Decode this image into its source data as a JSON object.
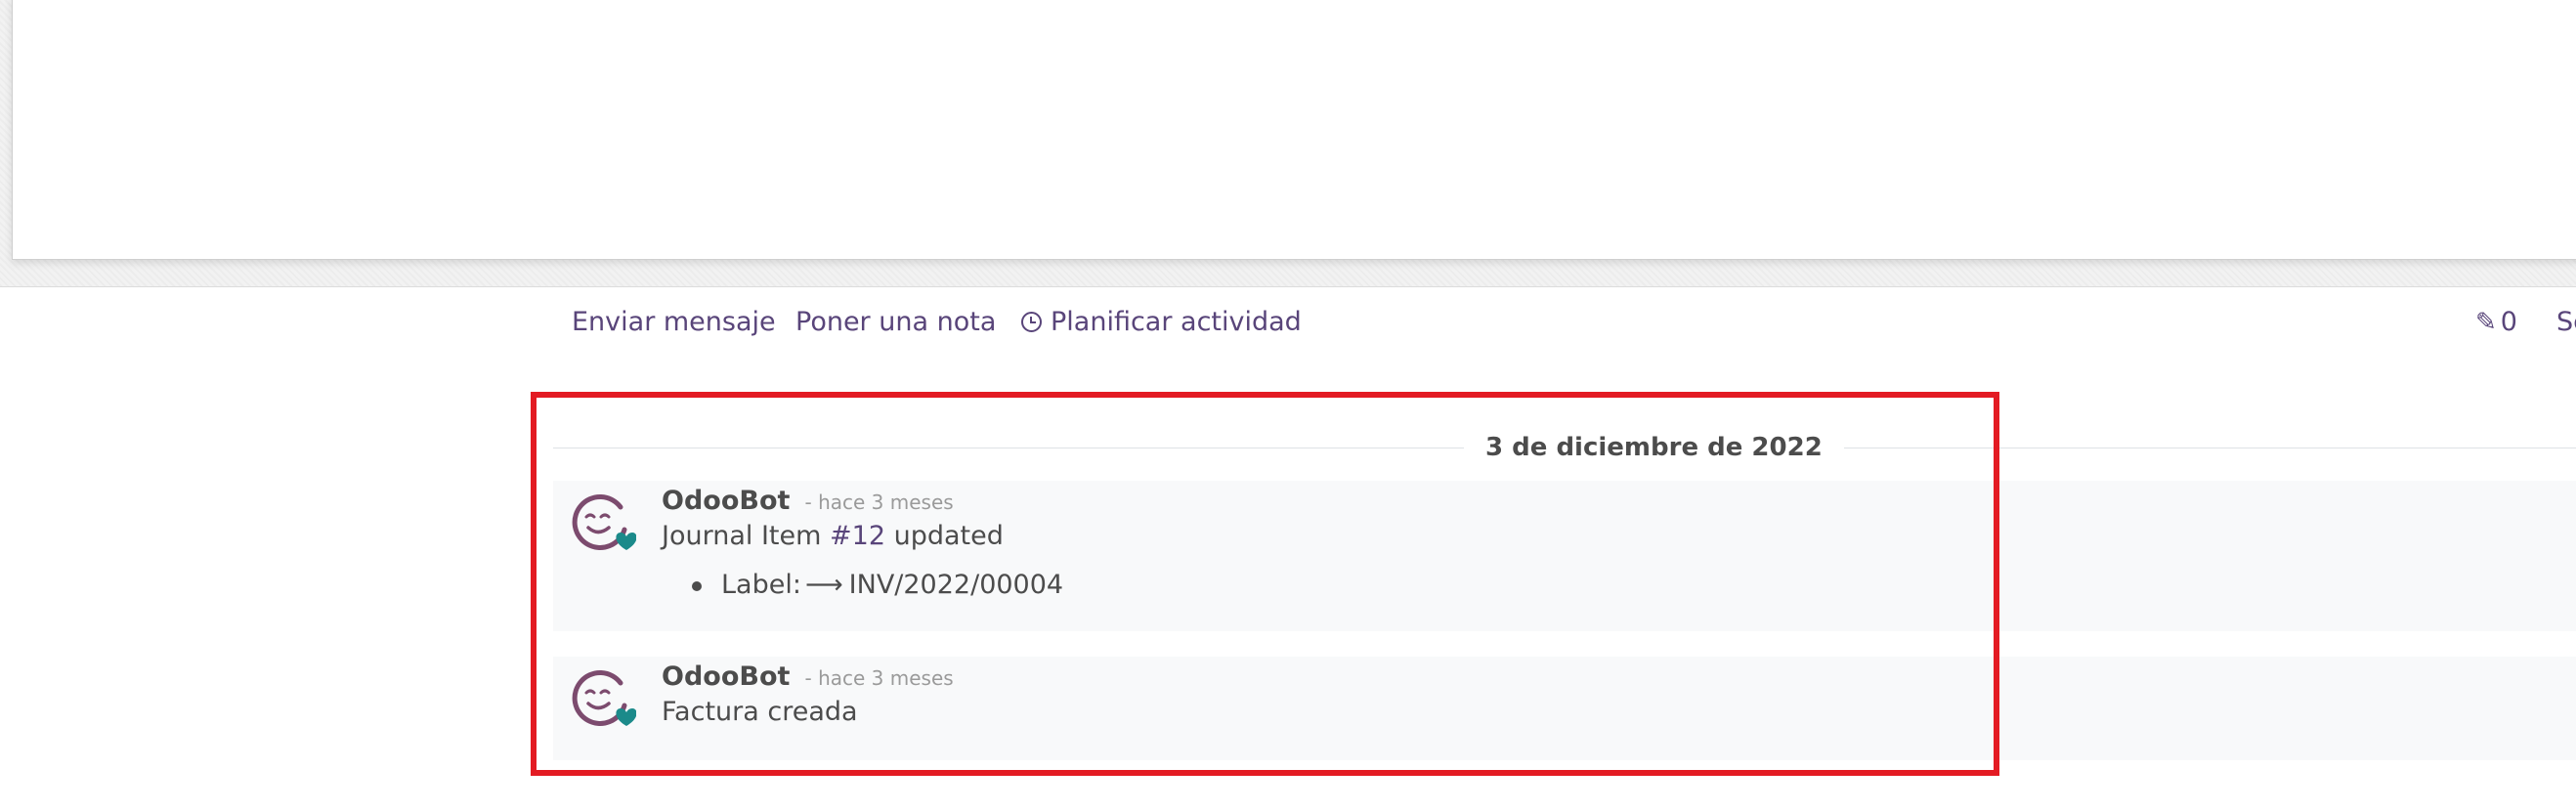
{
  "chatter": {
    "send_message": "Enviar mensaje",
    "log_note": "Poner una nota",
    "schedule_activity": "Planificar actividad",
    "attachments_count": "0",
    "follow_label": "Se"
  },
  "thread": {
    "date_separator": "3 de diciembre de 2022",
    "messages": [
      {
        "author": "OdooBot",
        "date": "- hace 3 meses",
        "body_prefix": "Journal Item ",
        "body_link": "#12",
        "body_suffix": " updated",
        "tracking_field": "Label:",
        "tracking_new_value": "INV/2022/00004"
      },
      {
        "author": "OdooBot",
        "date": "- hace 3 meses",
        "body": "Factura creada"
      }
    ]
  },
  "colors": {
    "link": "#59457a",
    "avatar_face": "#7c4b6e",
    "avatar_heart": "#1b8a8a",
    "highlight": "#e31b23",
    "message_bg": "#f8f9fa"
  },
  "icons": {
    "schedule": "clock-icon",
    "attachments": "paperclip-icon",
    "tracking_arrow": "long-arrow-right-icon",
    "avatar": "odoobot-face-icon"
  }
}
